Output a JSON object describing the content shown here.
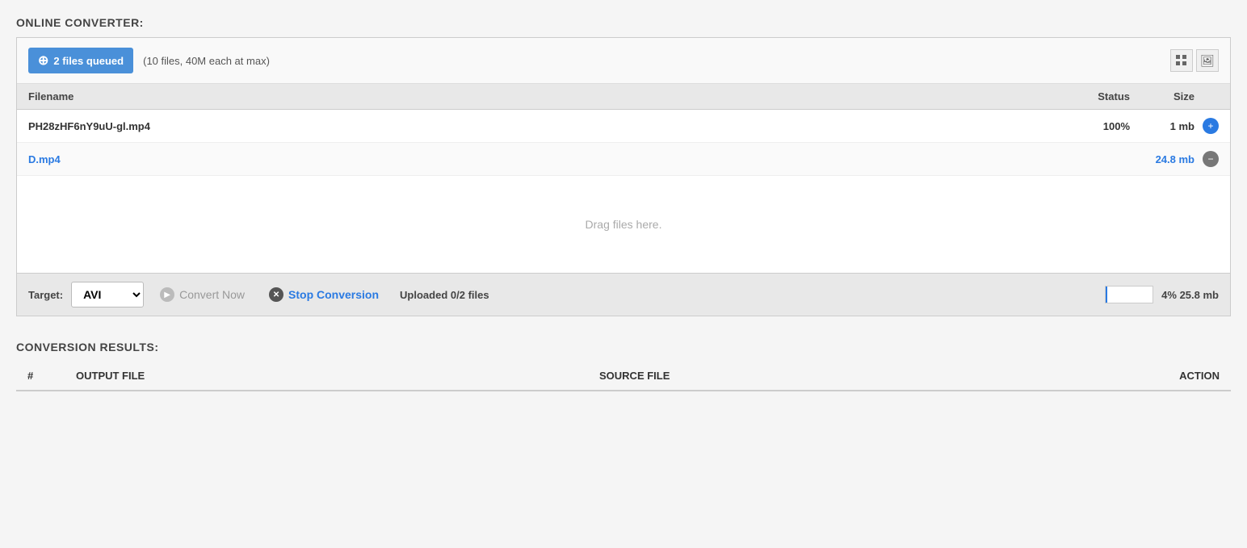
{
  "page": {
    "converter_title": "ONLINE CONVERTER:",
    "results_title": "CONVERSION RESULTS:"
  },
  "top_bar": {
    "add_button_label": "2 files queued",
    "file_limit_info": "(10 files, 40M each at max)",
    "view_grid_icon": "⊞",
    "view_image_icon": "🖼"
  },
  "file_table": {
    "col_filename": "Filename",
    "col_status": "Status",
    "col_size": "Size",
    "files": [
      {
        "name": "PH28zHF6nY9uU-gl.mp4",
        "status": "100%",
        "size": "1 mb",
        "is_link": false,
        "action_type": "add"
      },
      {
        "name": "D.mp4",
        "status": "",
        "size": "24.8 mb",
        "is_link": true,
        "action_type": "remove"
      }
    ],
    "drag_text": "Drag files here."
  },
  "bottom_bar": {
    "target_label": "Target:",
    "format_value": "AVI",
    "convert_now_label": "Convert Now",
    "stop_label": "Stop Conversion",
    "upload_status": "Uploaded 0/2 files",
    "progress_percent": 4,
    "progress_text": "4% 25.8 mb"
  },
  "results_table": {
    "col_num": "#",
    "col_output": "OUTPUT FILE",
    "col_source": "SOURCE FILE",
    "col_action": "ACTION"
  }
}
